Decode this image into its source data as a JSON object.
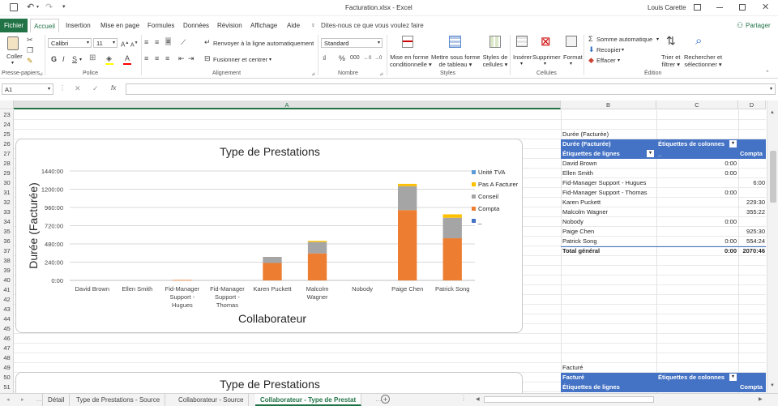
{
  "window": {
    "title": "Facturation.xlsx  -  Excel",
    "user": "Louis Carette"
  },
  "tabs": [
    "Fichier",
    "Accueil",
    "Insertion",
    "Mise en page",
    "Formules",
    "Données",
    "Révision",
    "Affichage",
    "Aide"
  ],
  "tell_me": "Dites-nous ce que vous voulez faire",
  "share": "Partager",
  "ribbon": {
    "paste": "Coller",
    "clipboard": "Presse-papiers",
    "font_name": "Calibri",
    "font_size": "11",
    "bold": "G",
    "italic": "I",
    "underline": "S",
    "font_group": "Police",
    "wrap": "Renvoyer à la ligne automatiquement",
    "merge": "Fusionner et centrer",
    "align_group": "Alignement",
    "number_format": "Standard",
    "number_group": "Nombre",
    "cond_format_1": "Mise en forme",
    "cond_format_2": "conditionnelle",
    "table_format_1": "Mettre sous forme",
    "table_format_2": "de tableau",
    "cell_styles_1": "Styles de",
    "cell_styles_2": "cellules",
    "styles_group": "Styles",
    "insert": "Insérer",
    "delete": "Supprimer",
    "format": "Format",
    "cells_group": "Cellules",
    "autosum": "Somme automatique",
    "fill": "Recopier",
    "clear": "Effacer",
    "sort_1": "Trier et",
    "sort_2": "filtrer",
    "find_1": "Rechercher et",
    "find_2": "sélectionner",
    "edit_group": "Édition"
  },
  "formula": {
    "name_box": "A1",
    "fx": "fx",
    "value": ""
  },
  "columns": [
    "A",
    "B",
    "C",
    "D"
  ],
  "rows": [
    "23",
    "24",
    "25",
    "26",
    "27",
    "28",
    "29",
    "30",
    "31",
    "32",
    "33",
    "34",
    "35",
    "36",
    "37",
    "38",
    "39",
    "40",
    "41",
    "42",
    "43",
    "44",
    "45",
    "46",
    "47",
    "48",
    "49",
    "50",
    "51"
  ],
  "pivot1": {
    "title": "Durée (Facturée)",
    "h1": "Durée (Facturée)",
    "h2": "Étiquettes de colonnes",
    "h3": "Étiquettes de lignes",
    "h4": "_",
    "h5": "Compta",
    "rows": [
      {
        "name": "David Brown",
        "c": "0:00",
        "d": ""
      },
      {
        "name": "Ellen Smith",
        "c": "0:00",
        "d": ""
      },
      {
        "name": "Fid-Manager Support - Hugues",
        "c": "",
        "d": "6:00"
      },
      {
        "name": "Fid-Manager Support - Thomas",
        "c": "0:00",
        "d": ""
      },
      {
        "name": "Karen Puckett",
        "c": "",
        "d": "229:30"
      },
      {
        "name": "Malcolm Wagner",
        "c": "",
        "d": "355:22"
      },
      {
        "name": "Nobody",
        "c": "0:00",
        "d": ""
      },
      {
        "name": "Paige Chen",
        "c": "",
        "d": "925:30"
      },
      {
        "name": "Patrick Song",
        "c": "0:00",
        "d": "554:24"
      }
    ],
    "total": {
      "name": "Total général",
      "c": "0:00",
      "d": "2070:46"
    }
  },
  "pivot2": {
    "title": "Facturé",
    "h1": "Facturé",
    "h2": "Étiquettes de colonnes",
    "h3": "Étiquettes de lignes",
    "h5": "Compta"
  },
  "chart_data": [
    {
      "type": "bar",
      "stacked": true,
      "title": "Type de Prestations",
      "xlabel": "Collaborateur",
      "ylabel": "Durée (Facturée)",
      "ylim": [
        0,
        1440
      ],
      "yticks": [
        "0:00",
        "240:00",
        "480:00",
        "720:00",
        "960:00",
        "1200:00",
        "1440:00"
      ],
      "categories": [
        [
          "David Brown"
        ],
        [
          "Ellen Smith"
        ],
        [
          "Fid-Manager",
          "Support -",
          "Hugues"
        ],
        [
          "Fid-Manager",
          "Support -",
          "Thomas"
        ],
        [
          "Karen Puckett"
        ],
        [
          "Malcolm",
          "Wagner"
        ],
        [
          "Nobody"
        ],
        [
          "Paige Chen"
        ],
        [
          "Patrick Song"
        ]
      ],
      "legend_position": "right",
      "series": [
        {
          "name": "_",
          "color": "#4472c4",
          "values": [
            0,
            0,
            0,
            0,
            0,
            0,
            0,
            0,
            0
          ]
        },
        {
          "name": "Compta",
          "color": "#ed7d31",
          "values": [
            0,
            0,
            6,
            0,
            229.5,
            355.4,
            0,
            925.5,
            554.4
          ]
        },
        {
          "name": "Conseil",
          "color": "#a5a5a5",
          "values": [
            0,
            0,
            0,
            0,
            80,
            150,
            0,
            315,
            270
          ]
        },
        {
          "name": "Pas A Facturer",
          "color": "#ffc000",
          "values": [
            0,
            0,
            0,
            0,
            0,
            15,
            0,
            30,
            45
          ]
        },
        {
          "name": "Unité TVA",
          "color": "#5b9bd5",
          "values": [
            0,
            0,
            0,
            0,
            0,
            0,
            0,
            0,
            0
          ]
        }
      ]
    },
    {
      "type": "bar",
      "title": "Type de Prestations"
    }
  ],
  "sheets": [
    "Détail",
    "Type de Prestations - Source",
    "Collaborateur - Source",
    "Collaborateur - Type de Prestat"
  ],
  "active_sheet": 3
}
